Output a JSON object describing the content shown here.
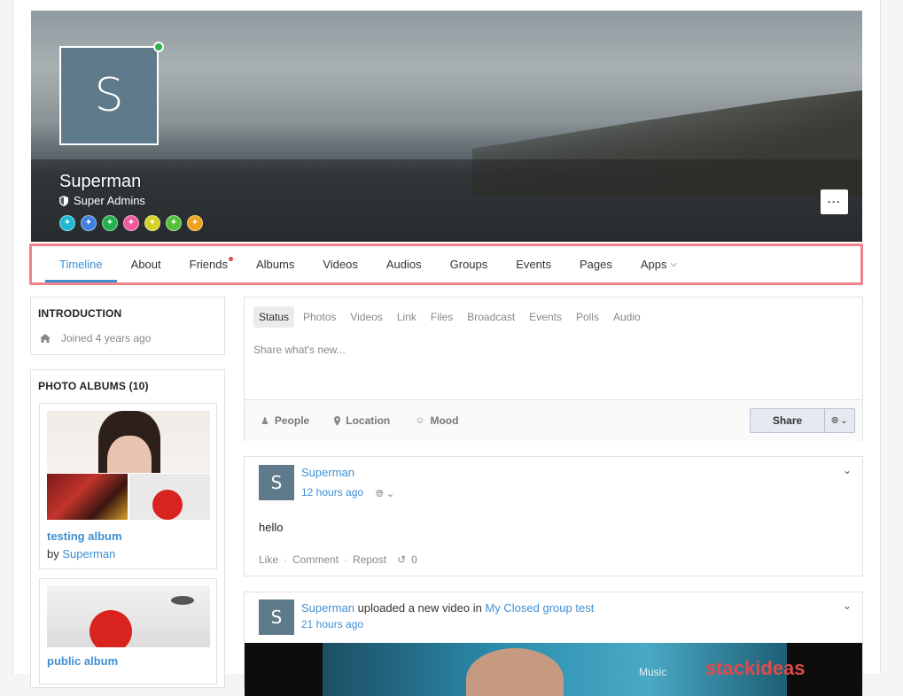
{
  "profile": {
    "avatar_letter": "S",
    "name": "Superman",
    "role": "Super Admins",
    "badge_colors": [
      "#1fb7d4",
      "#3f7fe0",
      "#22b14c",
      "#ef5b9c",
      "#d6d224",
      "#57c03b",
      "#f0a21b"
    ],
    "badge_icons": [
      "star-badge-icon",
      "square-badge-icon",
      "circle-badge-icon",
      "heart-badge-icon",
      "sun-badge-icon",
      "leaf-badge-icon",
      "trophy-badge-icon"
    ],
    "more_label": "···"
  },
  "tabs": [
    {
      "label": "Timeline",
      "active": true
    },
    {
      "label": "About"
    },
    {
      "label": "Friends",
      "notify": true
    },
    {
      "label": "Albums"
    },
    {
      "label": "Videos"
    },
    {
      "label": "Audios"
    },
    {
      "label": "Groups"
    },
    {
      "label": "Events"
    },
    {
      "label": "Pages"
    },
    {
      "label": "Apps",
      "dropdown": true
    }
  ],
  "intro": {
    "title": "INTRODUCTION",
    "joined": "Joined 4 years ago"
  },
  "albums": {
    "title": "PHOTO ALBUMS (10)",
    "items": [
      {
        "name": "testing album",
        "by_prefix": "by",
        "by_user": "Superman"
      },
      {
        "name": "public album"
      }
    ]
  },
  "composer": {
    "tabs": [
      "Status",
      "Photos",
      "Videos",
      "Link",
      "Files",
      "Broadcast",
      "Events",
      "Polls",
      "Audio"
    ],
    "placeholder": "Share what's new...",
    "people": "People",
    "location": "Location",
    "mood": "Mood",
    "share": "Share"
  },
  "posts": [
    {
      "author": "Superman",
      "time": "12 hours ago",
      "body": "hello",
      "like": "Like",
      "comment": "Comment",
      "repost": "Repost",
      "repost_count": "0"
    },
    {
      "author": "Superman",
      "action": "uploaded a new video in",
      "group": "My Closed group test",
      "time": "21 hours ago",
      "video_caption": "Music",
      "video_brand": "stackideas"
    }
  ],
  "colors": {
    "accent": "#3f8fd2",
    "highlight_border": "#f08389",
    "avatar_bg": "#5f7a8a"
  }
}
